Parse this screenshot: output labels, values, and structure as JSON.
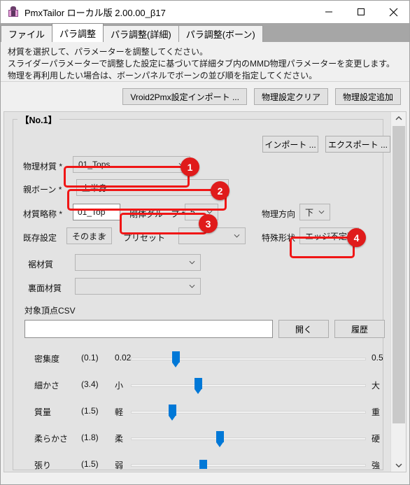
{
  "window": {
    "title": "PmxTailor ローカル版 2.00.00_β17",
    "icon": "app-figure-icon",
    "controls": {
      "minimize": "—",
      "maximize": "□",
      "close": "✕"
    }
  },
  "tabs": [
    {
      "label": "ファイル",
      "active": false
    },
    {
      "label": "パラ調整",
      "active": true
    },
    {
      "label": "パラ調整(詳細)",
      "active": false
    },
    {
      "label": "パラ調整(ボーン)",
      "active": false
    }
  ],
  "description": [
    "材質を選択して、パラメーターを調整してください。",
    "スライダーパラメーターで調整した設定に基づいて詳細タブ内のMMD物理パラメーターを変更します。",
    "物理を再利用したい場合は、ボーンパネルでボーンの並び順を指定してください。"
  ],
  "toolbar": {
    "import_vroid_label": "Vroid2Pmx設定インポート ...",
    "clear_label": "物理設定クリア",
    "add_label": "物理設定追加"
  },
  "group": {
    "title": "【No.1】",
    "import_label": "インポート ...",
    "export_label": "エクスポート ..."
  },
  "fields": {
    "material": {
      "label": "物理材質 *",
      "value": "01_Tops"
    },
    "parent_bone": {
      "label": "親ボーン *",
      "value": "上半身"
    },
    "material_abbr": {
      "label": "材質略称 *",
      "value": "01_Top"
    },
    "rigid_group": {
      "label": "剛体グループ *",
      "value": "5"
    },
    "physics_direction": {
      "label": "物理方向",
      "value": "下"
    },
    "existing_setting": {
      "label": "既存設定",
      "value": "そのまま"
    },
    "preset": {
      "label": "プリセット",
      "value": ""
    },
    "special_shape": {
      "label": "特殊形状",
      "value": "エッジ不定形"
    },
    "hem_material": {
      "label": "裾材質",
      "value": ""
    },
    "back_material": {
      "label": "裏面材質",
      "value": ""
    },
    "vertex_csv": {
      "label": "対象頂点CSV",
      "value": "",
      "open_label": "開く",
      "history_label": "履歴"
    }
  },
  "sliders": [
    {
      "name": "密集度",
      "range": "(0.1)",
      "min_label": "0.02",
      "max_label": "0.5",
      "pos": 0.19
    },
    {
      "name": "細かさ",
      "range": "(3.4)",
      "min_label": "小",
      "max_label": "大",
      "pos": 0.345
    },
    {
      "name": "質量",
      "range": "(1.5)",
      "min_label": "軽",
      "max_label": "重",
      "pos": 0.165
    },
    {
      "name": "柔らかさ",
      "range": "(1.8)",
      "min_label": "柔",
      "max_label": "硬",
      "pos": 0.37
    },
    {
      "name": "張り",
      "range": "(1.5)",
      "min_label": "弱",
      "max_label": "強",
      "pos": 0.315
    }
  ],
  "annotations": [
    {
      "number": "1"
    },
    {
      "number": "2"
    },
    {
      "number": "3"
    },
    {
      "number": "4"
    }
  ],
  "colors": {
    "accent_blue": "#0078d7",
    "annotation_red": "#e01b1b",
    "tab_active_bg": "#ffffff",
    "panel_bg": "#e3e3e3"
  }
}
